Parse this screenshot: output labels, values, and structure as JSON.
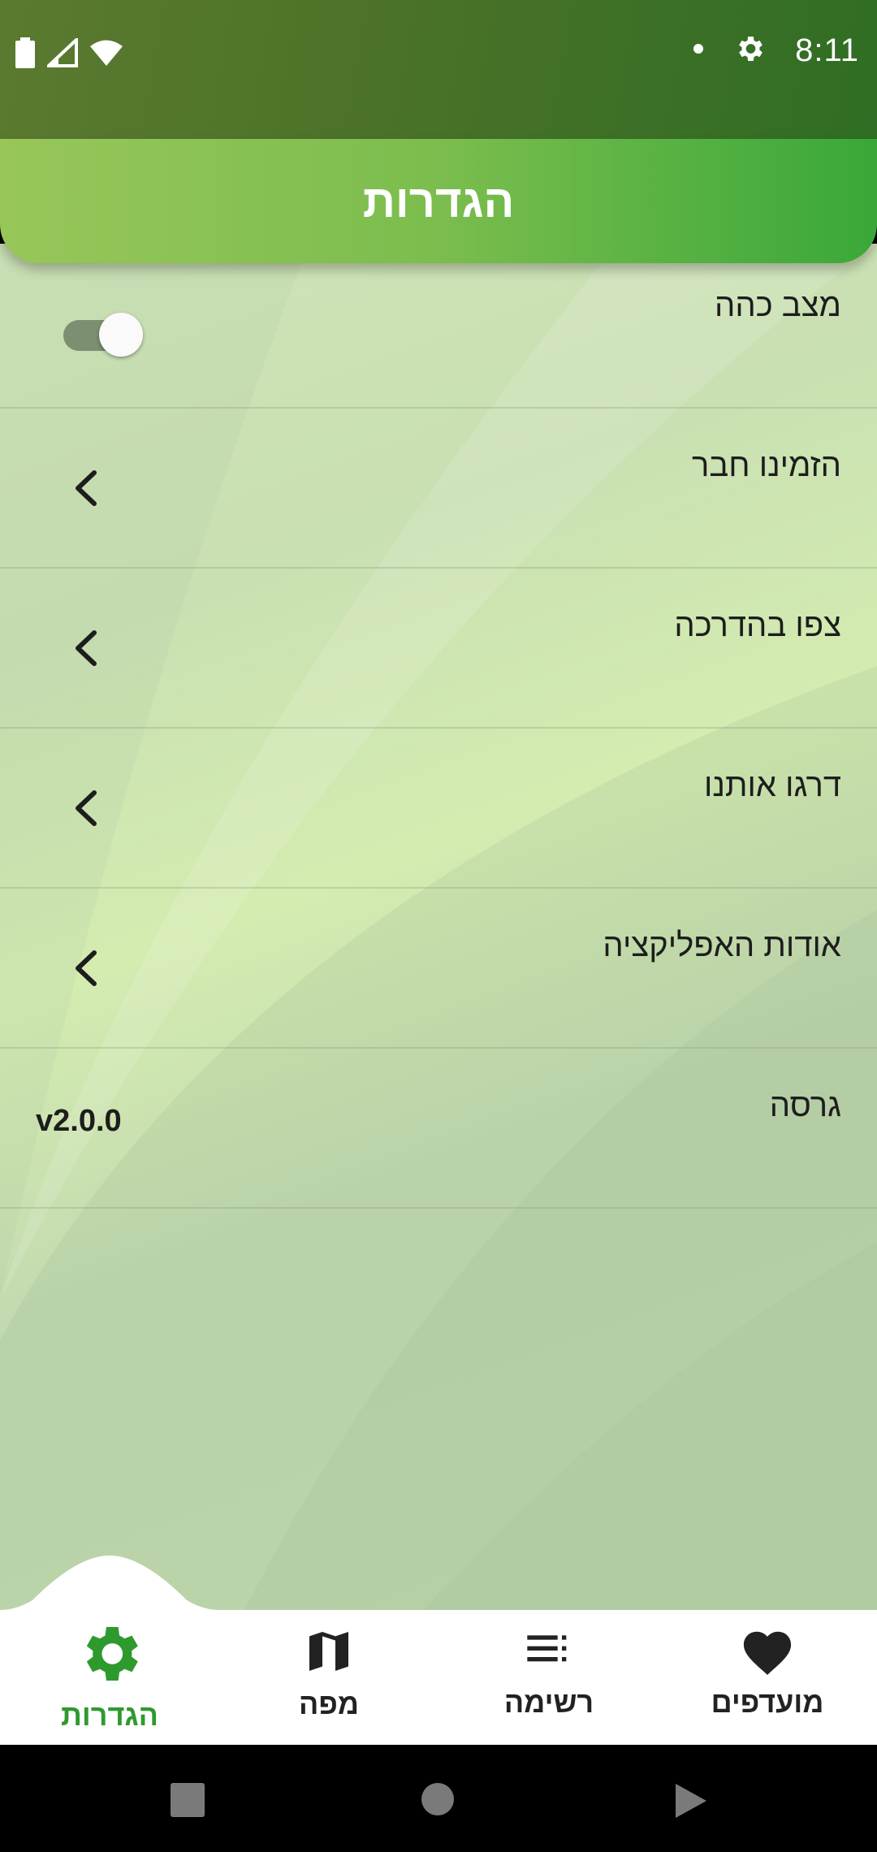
{
  "status_bar": {
    "time": "8:11"
  },
  "app_bar": {
    "title": "הגדרות"
  },
  "settings": {
    "dark_mode": {
      "label": "מצב כהה",
      "enabled": true
    },
    "invite_friend": {
      "label": "הזמינו חבר"
    },
    "watch_tutorial": {
      "label": "צפו בהדרכה"
    },
    "rate_us": {
      "label": "דרגו אותנו"
    },
    "about_app": {
      "label": "אודות האפליקציה"
    },
    "version": {
      "label": "גרסה",
      "value": "v2.0.0"
    }
  },
  "bottom_nav": {
    "favorites": "מועדפים",
    "list": "רשימה",
    "map": "מפה",
    "settings": "הגדרות",
    "active": "settings"
  },
  "colors": {
    "accent": "#2e9a2e",
    "app_bar_start": "#98c659",
    "app_bar_end": "#39a838"
  }
}
